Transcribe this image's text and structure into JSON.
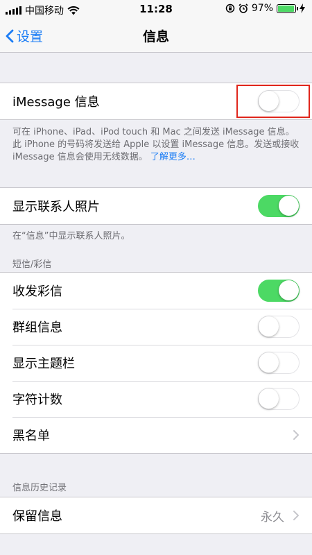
{
  "status_bar": {
    "carrier": "中国移动",
    "time": "11:28",
    "battery_percent": "97%",
    "battery_level": 0.97
  },
  "nav": {
    "back_label": "设置",
    "title": "信息"
  },
  "imessage": {
    "label": "iMessage 信息",
    "enabled": false,
    "footnote": "可在 iPhone、iPad、iPod touch 和 Mac 之间发送 iMessage 信息。此 iPhone 的号码将发送给 Apple 以设置 iMessage 信息。发送或接收 iMessage 信息会使用无线数据。",
    "learn_more": "了解更多…"
  },
  "contact_photos": {
    "label": "显示联系人照片",
    "enabled": true,
    "footnote": "在“信息”中显示联系人照片。"
  },
  "sms_mms": {
    "header": "短信/彩信",
    "rows": [
      {
        "label": "收发彩信",
        "enabled": true
      },
      {
        "label": "群组信息",
        "enabled": false
      },
      {
        "label": "显示主题栏",
        "enabled": false
      },
      {
        "label": "字符计数",
        "enabled": false
      }
    ],
    "blocked_label": "黑名单"
  },
  "history": {
    "header": "信息历史记录",
    "keep_label": "保留信息",
    "keep_value": "永久"
  },
  "colors": {
    "accent": "#1a7cf5",
    "toggle_on": "#4cd964",
    "highlight": "#e0261c"
  }
}
